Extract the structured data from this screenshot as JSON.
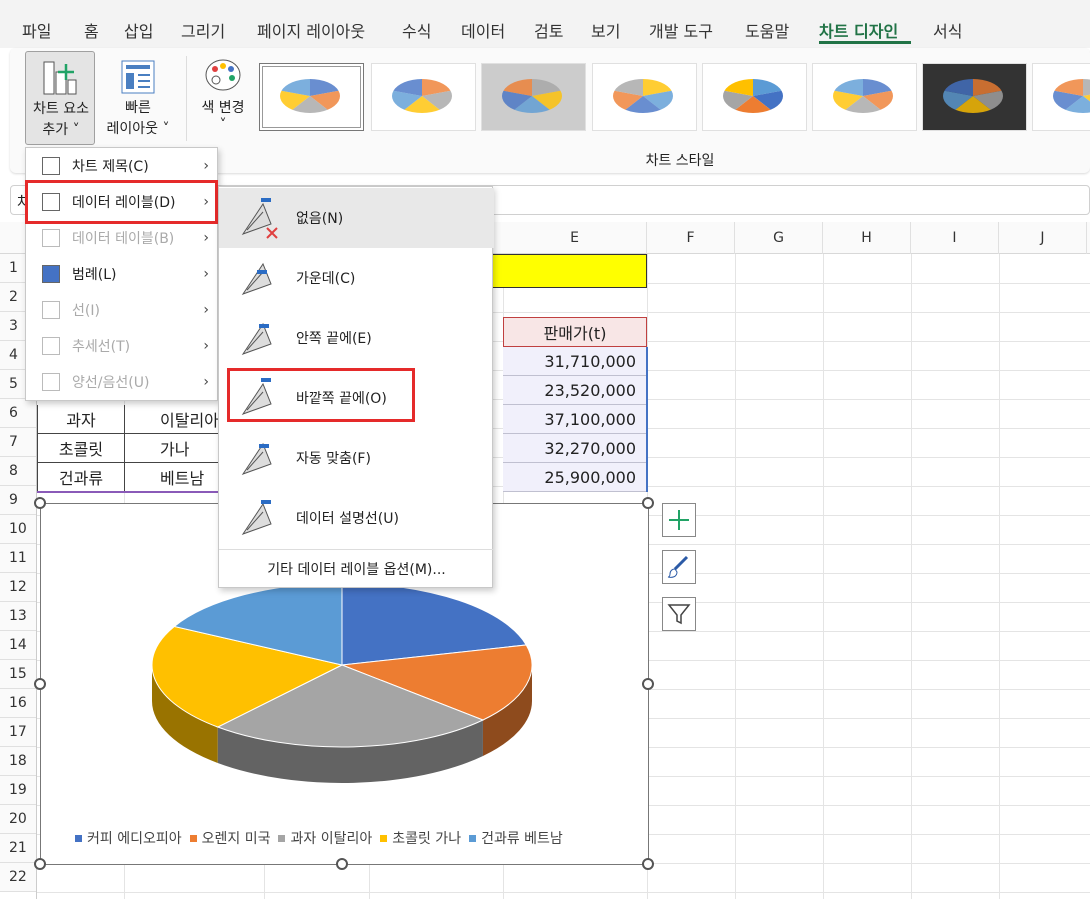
{
  "tabs": [
    "파일",
    "홈",
    "삽입",
    "그리기",
    "페이지 레이아웃",
    "수식",
    "데이터",
    "검토",
    "보기",
    "개발 도구",
    "도움말",
    "차트 디자인",
    "서식"
  ],
  "ribbon": {
    "add_element": [
      "차트 요소",
      "추가 ˅"
    ],
    "quick_layout": [
      "빠른",
      "레이아웃 ˅"
    ],
    "change_color": [
      "색 변경",
      "˅"
    ],
    "styles_group_label": "차트 스타일"
  },
  "name_box_char": "차",
  "columns": [
    "E",
    "F",
    "G",
    "H",
    "I",
    "J"
  ],
  "rows": [
    "1",
    "2",
    "3",
    "4",
    "5",
    "6",
    "7",
    "8",
    "9",
    "10",
    "11",
    "12",
    "13",
    "14",
    "15",
    "16",
    "17",
    "18",
    "19",
    "20",
    "21",
    "22"
  ],
  "table": {
    "header_price": "판매가(t)",
    "rows": [
      {
        "a": "",
        "b": "",
        "price": "31,710,000"
      },
      {
        "a": "",
        "b": "",
        "price": "23,520,000"
      },
      {
        "a": "과자",
        "b": "이탈리아",
        "price": "37,100,000"
      },
      {
        "a": "초콜릿",
        "b": "가나",
        "price": "32,270,000"
      },
      {
        "a": "건과류",
        "b": "베트남",
        "price": "25,900,000"
      }
    ]
  },
  "menu1": [
    {
      "label": "차트 제목(C)",
      "disabled": false
    },
    {
      "label": "데이터 레이블(D)",
      "disabled": false
    },
    {
      "label": "데이터 테이블(B)",
      "disabled": true
    },
    {
      "label": "범례(L)",
      "disabled": false
    },
    {
      "label": "선(I)",
      "disabled": true
    },
    {
      "label": "추세선(T)",
      "disabled": true
    },
    {
      "label": "양선/음선(U)",
      "disabled": true
    }
  ],
  "menu2": [
    {
      "label": "없음(N)"
    },
    {
      "label": "가운데(C)"
    },
    {
      "label": "안쪽 끝에(E)"
    },
    {
      "label": "바깥쪽 끝에(O)"
    },
    {
      "label": "자동 맞춤(F)"
    },
    {
      "label": "데이터 설명선(U)"
    }
  ],
  "menu2_more": "기타 데이터 레이블 옵션(M)...",
  "chart_data": {
    "type": "pie",
    "title": "",
    "categories": [
      "커피 에디오피아",
      "오렌지 미국",
      "과자 이탈리아",
      "초콜릿 가나",
      "건과류 베트남"
    ],
    "values": [
      31710000,
      23520000,
      37100000,
      32270000,
      25900000
    ],
    "colors": [
      "#4472c4",
      "#ed7d31",
      "#a5a5a5",
      "#ffc000",
      "#5b9bd5"
    ],
    "legend_position": "bottom"
  },
  "colors": {
    "accent": "#217346",
    "highlight_red": "#e52a2a",
    "yellow_cell": "#ffff00"
  }
}
